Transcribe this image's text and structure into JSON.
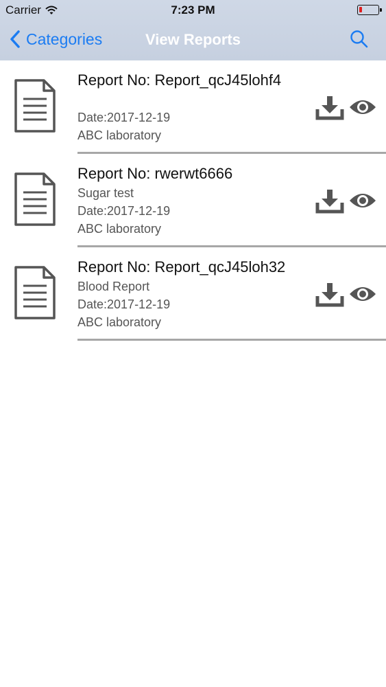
{
  "status_bar": {
    "carrier": "Carrier",
    "time": "7:23 PM",
    "wifi_icon": "wifi-icon",
    "battery_icon": "battery-low-icon",
    "battery_color": "#e02020"
  },
  "nav": {
    "back_label": "Categories",
    "back_icon": "chevron-left-icon",
    "title": "View Reports",
    "search_icon": "search-icon",
    "accent_color": "#1b7cf2"
  },
  "reports": [
    {
      "title": "Report No: Report_qcJ45lohf4",
      "type": "",
      "date": "Date:2017-12-19",
      "lab": "ABC laboratory"
    },
    {
      "title": "Report No: rwerwt6666",
      "type": "Sugar test",
      "date": "Date:2017-12-19",
      "lab": "ABC laboratory"
    },
    {
      "title": "Report No: Report_qcJ45loh32",
      "type": "Blood Report",
      "date": "Date:2017-12-19",
      "lab": "ABC laboratory"
    }
  ],
  "row_icons": {
    "document": "document-icon",
    "download": "download-icon",
    "view": "eye-icon"
  }
}
